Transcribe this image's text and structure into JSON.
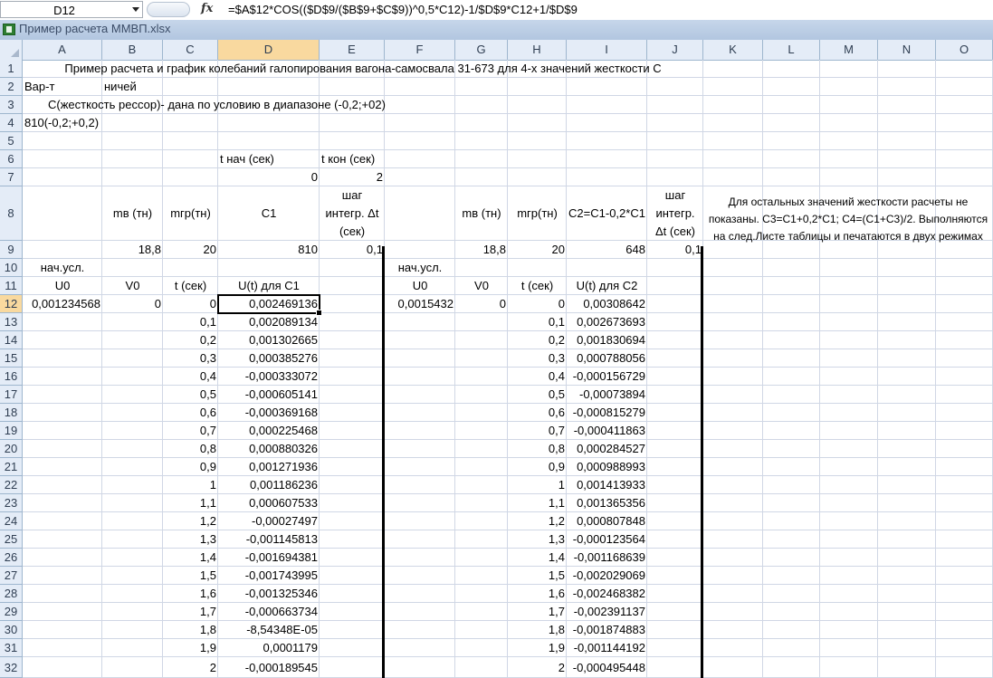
{
  "namebox": "D12",
  "formula": "=$A$12*COS(($D$9/($B$9+$C$9))^0,5*C12)-1/$D$9*C12+1/$D$9",
  "workbook_title": "Пример расчета ММВП.xlsx",
  "columns": [
    "A",
    "B",
    "C",
    "D",
    "E",
    "F",
    "G",
    "H",
    "I",
    "J",
    "K",
    "L",
    "M",
    "N",
    "O"
  ],
  "rows": [
    "1",
    "2",
    "3",
    "4",
    "5",
    "6",
    "7",
    "8",
    "9",
    "10",
    "11",
    "12",
    "13",
    "14",
    "15",
    "16",
    "17",
    "18",
    "19",
    "20",
    "21",
    "22",
    "23",
    "24",
    "25",
    "26",
    "27",
    "28",
    "29",
    "30",
    "31",
    "32"
  ],
  "cells": {
    "r1_title": "Пример расчета и график колебаний галопирования вагона-самосвала 31-673 для 4-х значений жесткости С",
    "r2_a": "Вар-т",
    "r2_b": "ничей",
    "r3_text": "С(жесткость рессор)- дана по условию в диапазоне (-0,2;+02)",
    "r4_a": "810(-0,2;+0,2)",
    "r6_d": "t нач (сек)",
    "r6_e": "t кон (сек)",
    "r7_d": "0",
    "r7_e": "2",
    "r8_b": "mв (тн)",
    "r8_c": "mгр(тн)",
    "r8_d": "C1",
    "r8_e": "шаг интегр. Δt (сек)",
    "r8_g": "mв (тн)",
    "r8_h": "mгр(тн)",
    "r8_i": "C2=C1-0,2*C1",
    "r8_j": "шаг интегр. Δt (сек)",
    "r8_note": "Для остальных значений жесткости расчеты не показаны. С3=С1+0,2*С1; С4=(С1+С3)/2. Выполняются на след.Листе таблицы и печатаются в двух режимах",
    "r9_b": "18,8",
    "r9_c": "20",
    "r9_d": "810",
    "r9_e": "0,1",
    "r9_g": "18,8",
    "r9_h": "20",
    "r9_i": "648",
    "r9_j": "0,1",
    "r10_a": "нач.усл.",
    "r10_f": "нач.усл.",
    "r11_a": "U0",
    "r11_b": "V0",
    "r11_c": "t (сек)",
    "r11_d": "U(t) для С1",
    "r11_f": "U0",
    "r11_g": "V0",
    "r11_h": "t (сек)",
    "r11_i": "U(t) для С2",
    "r12_a": "0,001234568",
    "r12_b": "0",
    "r12_f": "0,0015432",
    "r12_g": "0"
  },
  "t_values": [
    "0",
    "0,1",
    "0,2",
    "0,3",
    "0,4",
    "0,5",
    "0,6",
    "0,7",
    "0,8",
    "0,9",
    "1",
    "1,1",
    "1,2",
    "1,3",
    "1,4",
    "1,5",
    "1,6",
    "1,7",
    "1,8",
    "1,9",
    "2"
  ],
  "u_c1": [
    "0,002469136",
    "0,002089134",
    "0,001302665",
    "0,000385276",
    "-0,000333072",
    "-0,000605141",
    "-0,000369168",
    "0,000225468",
    "0,000880326",
    "0,001271936",
    "0,001186236",
    "0,000607533",
    "-0,00027497",
    "-0,001145813",
    "-0,001694381",
    "-0,001743995",
    "-0,001325346",
    "-0,000663734",
    "-8,54348E-05",
    "0,0001179",
    "-0,000189545"
  ],
  "t_values_2": [
    "0",
    "0,1",
    "0,2",
    "0,3",
    "0,4",
    "0,5",
    "0,6",
    "0,7",
    "0,8",
    "0,9",
    "1",
    "1,1",
    "1,2",
    "1,3",
    "1,4",
    "1,5",
    "1,6",
    "1,7",
    "1,8",
    "1,9",
    "2"
  ],
  "u_c2": [
    "0,00308642",
    "0,002673693",
    "0,001830694",
    "0,000788056",
    "-0,000156729",
    "-0,00073894",
    "-0,000815279",
    "-0,000411863",
    "0,000284527",
    "0,000988993",
    "0,001413933",
    "0,001365356",
    "0,000807848",
    "-0,000123564",
    "-0,001168639",
    "-0,002029069",
    "-0,002468382",
    "-0,002391137",
    "-0,001874883",
    "-0,001144192",
    "-0,000495448"
  ]
}
